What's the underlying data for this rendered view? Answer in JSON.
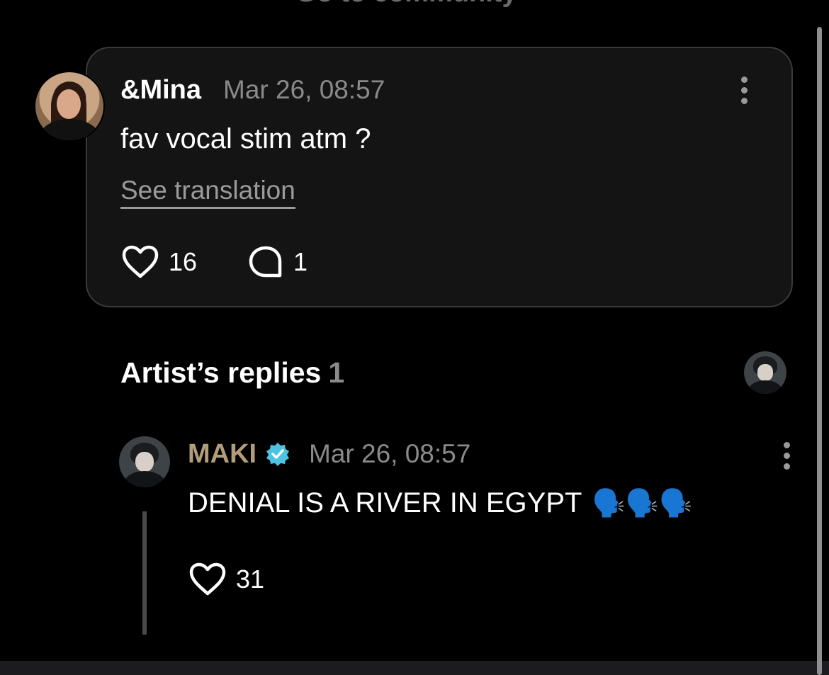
{
  "top": {
    "community_link": "Go to community ›"
  },
  "post": {
    "author": "&Mina",
    "date": "Mar 26, 08:57",
    "body": "fav vocal stim atm ?",
    "see_translation": "See translation",
    "likes": "16",
    "comments": "1"
  },
  "replies_section": {
    "title": "Artist’s replies",
    "count": "1"
  },
  "reply": {
    "author": "MAKI",
    "date": "Mar 26, 08:57",
    "body": "DENIAL IS A RIVER IN EGYPT",
    "emojis": "🗣️🗣️🗣️",
    "likes": "31"
  },
  "icons": {
    "like": "heart-icon",
    "comment": "comment-bubble-icon",
    "more": "more-vertical-icon",
    "verified": "verified-badge-icon"
  },
  "colors": {
    "background": "#000000",
    "card": "#141414",
    "artist_name": "#b39c7a",
    "verified": "#4cc3e0",
    "muted_text": "#8a8a8a"
  }
}
